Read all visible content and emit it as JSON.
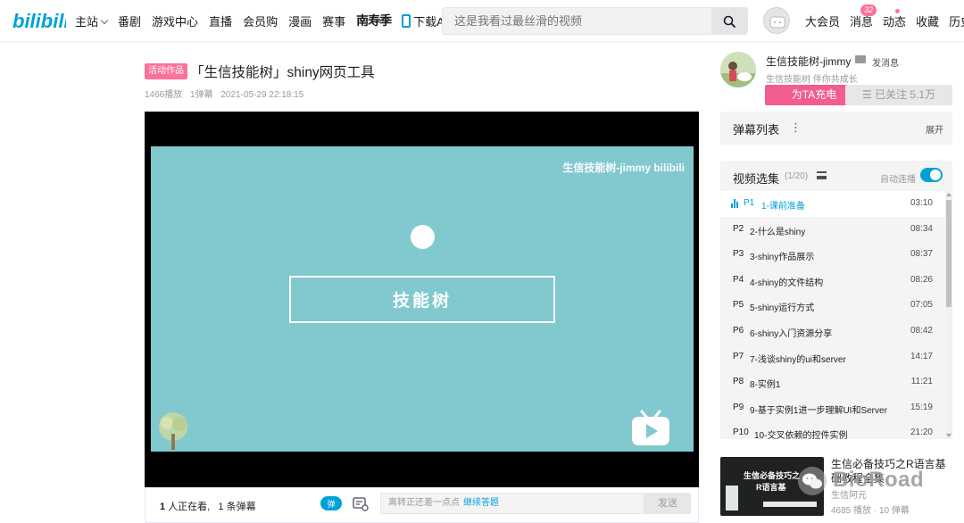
{
  "header": {
    "nav": [
      "主站",
      "番剧",
      "游戏中心",
      "直播",
      "会员购",
      "漫画",
      "赛事"
    ],
    "promo_brand": "南寿季",
    "download_app": "下载APP",
    "search_placeholder": "这是我看过最丝滑的视频",
    "right": [
      "大会员",
      "消息",
      "动态",
      "收藏",
      "历史"
    ],
    "message_count": "32"
  },
  "video": {
    "tag": "活动作品",
    "title": "「生信技能树」shiny网页工具",
    "plays": "1466播放",
    "danmaku": "1弹幕",
    "date": "2021-05-29 22:18:15"
  },
  "player": {
    "watermark": "生信技能树-jimmy bilibili",
    "center_text": "技能树"
  },
  "danmaku_bar": {
    "viewers": "1",
    "viewers_label": "人正在看,",
    "danmaku_count": "1",
    "danmaku_label": "条弹幕",
    "toggle_label": "弹",
    "input_hint": "离转正还差一点点",
    "input_link": "继续答题",
    "send": "发送"
  },
  "up": {
    "name": "生信技能树-jimmy",
    "send_message": "发消息",
    "desc": "生信技能树 伴你共成长",
    "charge": "为TA充电",
    "follow": "已关注 5.1万"
  },
  "danmaku_list": {
    "title": "弹幕列表",
    "menu": "⋮",
    "expand": "展开"
  },
  "playlist": {
    "title": "视频选集",
    "count": "(1/20)",
    "autoplay": "自动连播",
    "items": [
      {
        "p": "P1",
        "name": "1-课前准备",
        "duration": "03:10"
      },
      {
        "p": "P2",
        "name": "2-什么是shiny",
        "duration": "08:34"
      },
      {
        "p": "P3",
        "name": "3-shiny作品展示",
        "duration": "08:37"
      },
      {
        "p": "P4",
        "name": "4-shiny的文件结构",
        "duration": "08:26"
      },
      {
        "p": "P5",
        "name": "5-shiny运行方式",
        "duration": "07:05"
      },
      {
        "p": "P6",
        "name": "6-shiny入门资源分享",
        "duration": "08:42"
      },
      {
        "p": "P7",
        "name": "7-浅谈shiny的ui和server",
        "duration": "14:17"
      },
      {
        "p": "P8",
        "name": "8-实例1",
        "duration": "11:21"
      },
      {
        "p": "P9",
        "name": "9-基于实例1进一步理解UI和Server",
        "duration": "15:19"
      },
      {
        "p": "P10",
        "name": "10-交叉依赖的控件实例",
        "duration": "21:20"
      }
    ]
  },
  "recommend": {
    "title": "生信必备技巧之R语言基础教程全集",
    "thumb_line1": "生信必备技巧之",
    "thumb_line2": "R语言基",
    "author": "生信阿元",
    "stats": "4685 播放 · 10 弹幕"
  },
  "watermark_overlay": "BioRoad"
}
